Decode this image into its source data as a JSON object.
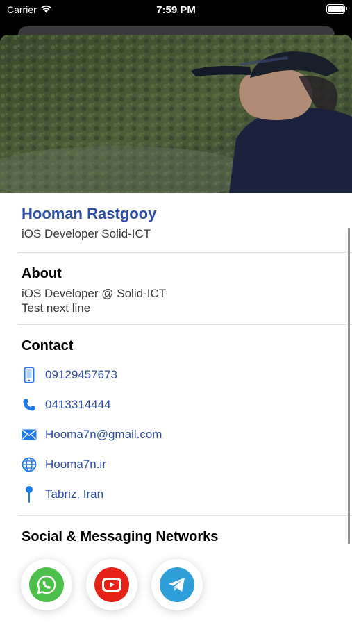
{
  "status_bar": {
    "carrier": "Carrier",
    "time": "7:59 PM",
    "battery_level": 1.0
  },
  "profile": {
    "name": "Hooman Rastgooy",
    "role": "iOS Developer Solid-ICT"
  },
  "about": {
    "title": "About",
    "line1": "iOS Developer @ Solid-ICT",
    "line2": "Test next line"
  },
  "contact": {
    "title": "Contact",
    "items": [
      {
        "icon": "mobile-phone-icon",
        "text": "09129457673"
      },
      {
        "icon": "phone-icon",
        "text": "0413314444"
      },
      {
        "icon": "mail-icon",
        "text": "Hooma7n@gmail.com"
      },
      {
        "icon": "globe-icon",
        "text": "Hooma7n.ir"
      },
      {
        "icon": "location-pin-icon",
        "text": "Tabriz, Iran"
      }
    ]
  },
  "social": {
    "title": "Social & Messaging Networks",
    "items": [
      {
        "icon": "whatsapp-icon",
        "color": "#4cc04a"
      },
      {
        "icon": "youtube-icon",
        "color": "#e62117"
      },
      {
        "icon": "telegram-icon",
        "color": "#2f9fd9"
      }
    ]
  },
  "colors": {
    "accent": "#2d4ea4",
    "icon_blue": "#1e7be8"
  }
}
